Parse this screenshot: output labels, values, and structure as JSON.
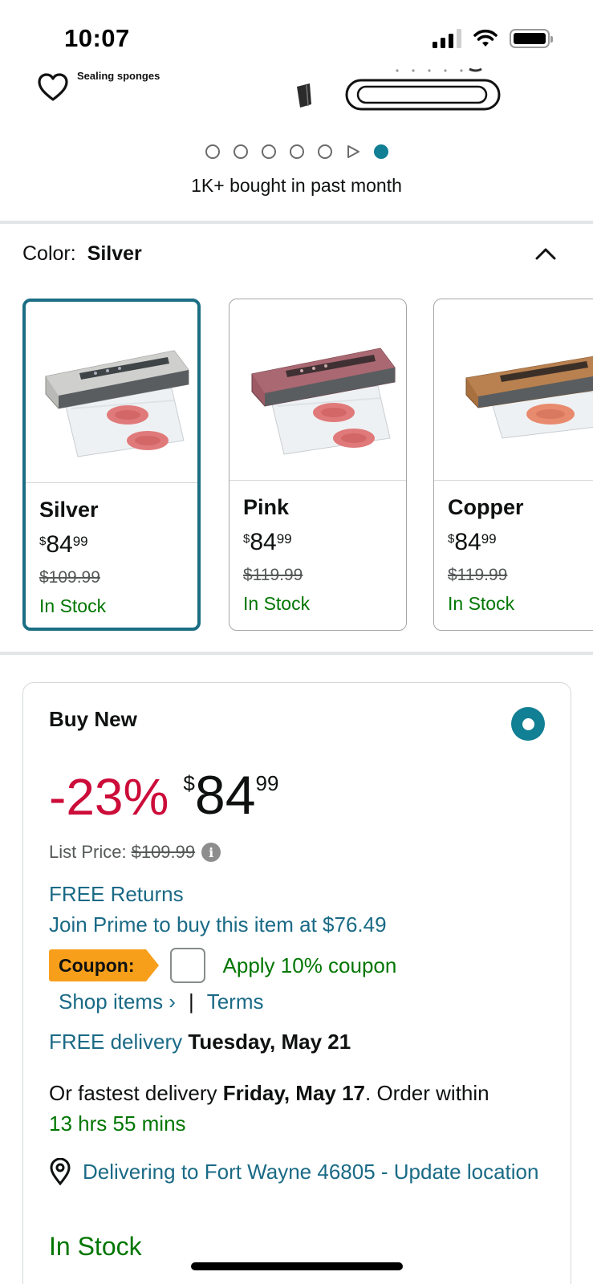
{
  "status_bar": {
    "time": "10:07"
  },
  "image_gallery": {
    "caption": "Sealing sponges",
    "dot_count": 7,
    "active_dot_index": 6,
    "bought_text": "1K+ bought in past month"
  },
  "color_selector": {
    "label": "Color:",
    "selected": "Silver",
    "options": [
      {
        "name": "Silver",
        "price_symbol": "$",
        "price_whole": "84",
        "price_fraction": "99",
        "list_price": "$109.99",
        "stock": "In Stock",
        "machine_color": "#b9b9b6"
      },
      {
        "name": "Pink",
        "price_symbol": "$",
        "price_whole": "84",
        "price_fraction": "99",
        "list_price": "$119.99",
        "stock": "In Stock",
        "machine_color": "#9b5a64"
      },
      {
        "name": "Copper",
        "price_symbol": "$",
        "price_whole": "84",
        "price_fraction": "99",
        "list_price": "$119.99",
        "stock": "In Stock",
        "machine_color": "#a8703f"
      }
    ]
  },
  "buy_box": {
    "title": "Buy New",
    "discount": "-23%",
    "price_symbol": "$",
    "price_whole": "84",
    "price_fraction": "99",
    "list_price_label": "List Price:",
    "list_price": "$109.99",
    "free_returns": "FREE Returns",
    "join_prime": "Join Prime to buy this item at $76.49",
    "coupon_label": "Coupon:",
    "apply_coupon": "Apply 10% coupon",
    "shop_items": "Shop items ›",
    "separator": "|",
    "terms": "Terms",
    "free_delivery_label": "FREE delivery",
    "free_delivery_date": "Tuesday, May 21",
    "fastest_prefix": "Or fastest delivery",
    "fastest_date": "Friday, May 17",
    "fastest_suffix": ". Order within",
    "order_within": "13 hrs 55 mins",
    "deliver_to": "Delivering to Fort Wayne 46805 - Update location",
    "in_stock": "In Stock"
  },
  "colors": {
    "accent_teal": "#117f94",
    "link": "#1a6a86",
    "green": "#007600",
    "discount_red": "#cc0c39",
    "coupon_orange": "#f79f1b"
  }
}
